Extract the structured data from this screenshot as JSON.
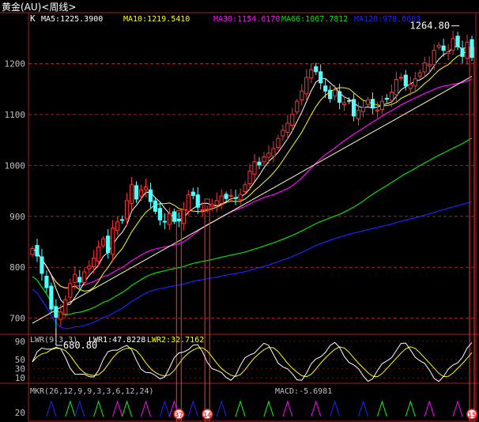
{
  "window": {
    "title": "黄金(AU)<周线>"
  },
  "colors": {
    "background": "#000000",
    "up": "#ff3232",
    "down": "#54ffff",
    "grid": "#a02020",
    "axis_text": "#c0c0c0",
    "ma5": "#ffffff",
    "ma10": "#ffff00",
    "ma30": "#ff00ff",
    "ma66": "#00e000",
    "ma120": "#2020ff",
    "trendline": "#ffffc0"
  },
  "legend": {
    "k_label": "K",
    "items": [
      {
        "text": "MA5:1225.3900",
        "color": "#ffffff"
      },
      {
        "text": "MA10:1219.5410",
        "color": "#ffff00"
      },
      {
        "text": "MA30:1154.6170",
        "color": "#ff00ff"
      },
      {
        "text": "MA66:1067.7812",
        "color": "#00e000"
      },
      {
        "text": "MA120:978.6663",
        "color": "#2020ff"
      }
    ]
  },
  "annotations": {
    "high": "1264.80",
    "low": "680.80"
  },
  "lwr_panel": {
    "title": "LWR(9,3,3)",
    "items": [
      {
        "text": "LWR1:47.8228",
        "color": "#ffffff"
      },
      {
        "text": "LWR2:32.7162",
        "color": "#ffff00"
      }
    ],
    "ticks": [
      "90",
      "50",
      "30",
      "10"
    ]
  },
  "mkr_panel": {
    "title": "MKR(26,12,9,9,3,3,6,12,24)",
    "macd": "MACD:-5.6981",
    "tick": "20",
    "markers": [
      "37",
      "14",
      "15"
    ]
  },
  "chart_data": {
    "type": "candlestick",
    "y_ticks": [
      700,
      800,
      900,
      1000,
      1100,
      1200
    ],
    "ylim": [
      670,
      1300
    ],
    "high": 1264.8,
    "low": 680.8,
    "trendline": {
      "from": [
        0,
        690
      ],
      "to": [
        93,
        1175
      ]
    },
    "vertical_markers": [
      {
        "bar": 31,
        "label": "37"
      },
      {
        "bar": 37,
        "label": "14"
      },
      {
        "bar": 93,
        "label": "15"
      }
    ],
    "closes": [
      837,
      822,
      788,
      760,
      718,
      702,
      712,
      736,
      768,
      786,
      771,
      791,
      802,
      818,
      840,
      856,
      829,
      877,
      889,
      892,
      931,
      962,
      934,
      952,
      958,
      929,
      910,
      893,
      889,
      905,
      890,
      891,
      913,
      942,
      941,
      918,
      913,
      914,
      924,
      931,
      940,
      935,
      941,
      936,
      943,
      962,
      989,
      1007,
      1001,
      1017,
      1024,
      1033,
      1053,
      1069,
      1083,
      1100,
      1126,
      1146,
      1173,
      1188,
      1184,
      1162,
      1146,
      1131,
      1148,
      1124,
      1123,
      1126,
      1097,
      1108,
      1114,
      1129,
      1113,
      1109,
      1126,
      1130,
      1144,
      1169,
      1173,
      1156,
      1159,
      1170,
      1182,
      1201,
      1198,
      1226,
      1236,
      1226,
      1223,
      1249,
      1234,
      1214,
      1242,
      1212
    ],
    "ma5_last": 1225.39,
    "ma10_last": 1219.541,
    "ma30_last": 1154.617,
    "ma66_last": 1067.7812,
    "ma120_last": 978.6663,
    "lwr1_last": 47.8228,
    "lwr2_last": 32.7162,
    "lwr_ticks": [
      90,
      50,
      30,
      10
    ],
    "macd_last": -5.6981
  }
}
